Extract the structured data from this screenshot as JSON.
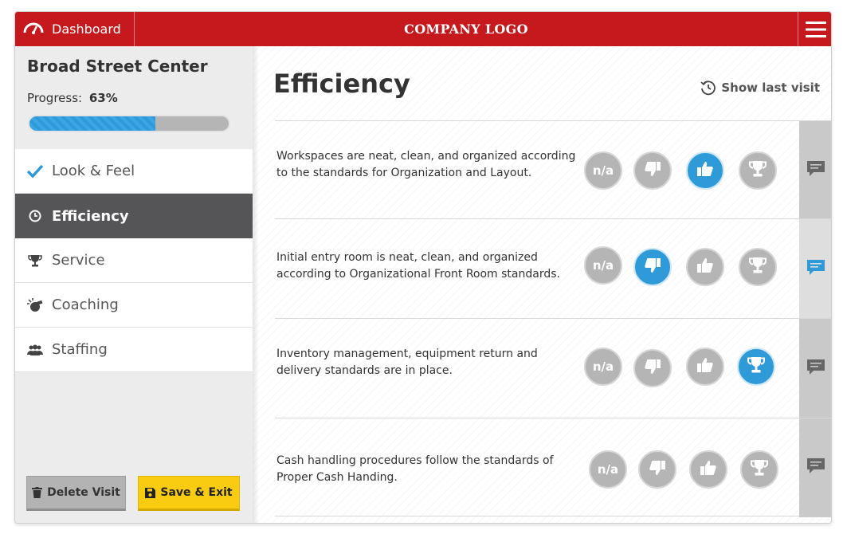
{
  "header": {
    "dashboard_label": "Dashboard",
    "logo_text": "COMPANY LOGO",
    "brand_color": "#c6191e"
  },
  "sidebar": {
    "center_name": "Broad Street Center",
    "progress_label": "Progress:",
    "progress_value": "63%",
    "progress_fraction": 0.63,
    "items": [
      {
        "label": "Look & Feel",
        "icon": "check-icon",
        "state": "done"
      },
      {
        "label": "Efficiency",
        "icon": "clock-icon",
        "state": "active"
      },
      {
        "label": "Service",
        "icon": "trophy-icon",
        "state": ""
      },
      {
        "label": "Coaching",
        "icon": "whistle-icon",
        "state": ""
      },
      {
        "label": "Staffing",
        "icon": "people-icon",
        "state": ""
      }
    ],
    "delete_label": "Delete Visit",
    "save_label": "Save & Exit"
  },
  "main": {
    "title": "Efficiency",
    "last_visit_label": "Show last visit",
    "na_label": "n/a",
    "accent_color": "#2f9ad8",
    "questions": [
      {
        "text": "Workspaces are neat, clean, and organized according to the standards for Organization and Layout.",
        "selected": "thumbs-up",
        "comment_active": false
      },
      {
        "text": "Initial entry room is neat, clean, and organized according to Organizational Front Room standards.",
        "selected": "thumbs-down",
        "comment_active": true
      },
      {
        "text": "Inventory management, equipment return and delivery standards are in place.",
        "selected": "trophy",
        "comment_active": false
      },
      {
        "text": "Cash handling procedures follow the standards of Proper Cash Handing.",
        "selected": "none",
        "comment_active": false
      }
    ]
  }
}
